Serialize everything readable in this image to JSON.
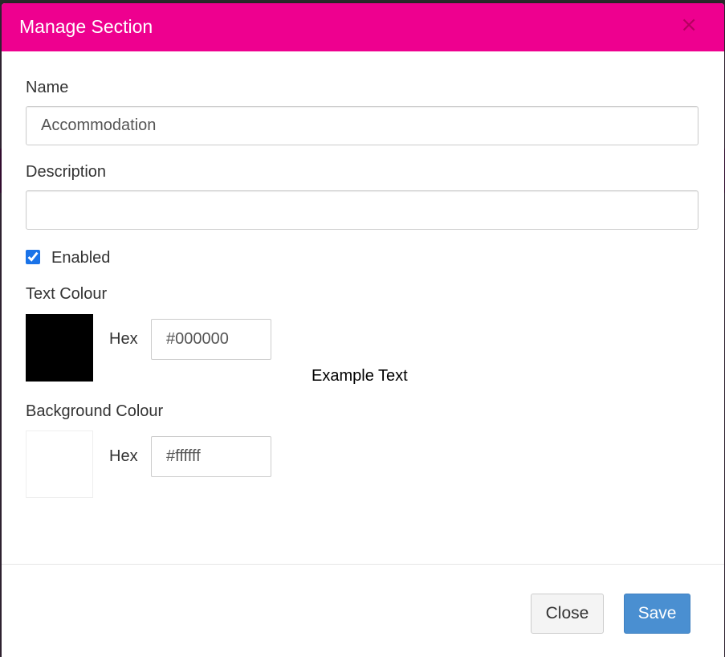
{
  "modal": {
    "title": "Manage Section",
    "close_glyph": "×"
  },
  "form": {
    "name": {
      "label": "Name",
      "value": "Accommodation"
    },
    "description": {
      "label": "Description",
      "value": ""
    },
    "enabled": {
      "label": "Enabled",
      "checked": true
    },
    "text_colour": {
      "label": "Text Colour",
      "hex_label": "Hex",
      "hex_value": "#000000",
      "swatch_color": "#000000"
    },
    "background_colour": {
      "label": "Background Colour",
      "hex_label": "Hex",
      "hex_value": "#ffffff",
      "swatch_color": "#ffffff"
    },
    "example_text": "Example Text"
  },
  "footer": {
    "close_label": "Close",
    "save_label": "Save"
  },
  "colors": {
    "header": "#ee008f",
    "save_button": "#4a8fd1"
  },
  "icons": {
    "close": "close-icon"
  }
}
